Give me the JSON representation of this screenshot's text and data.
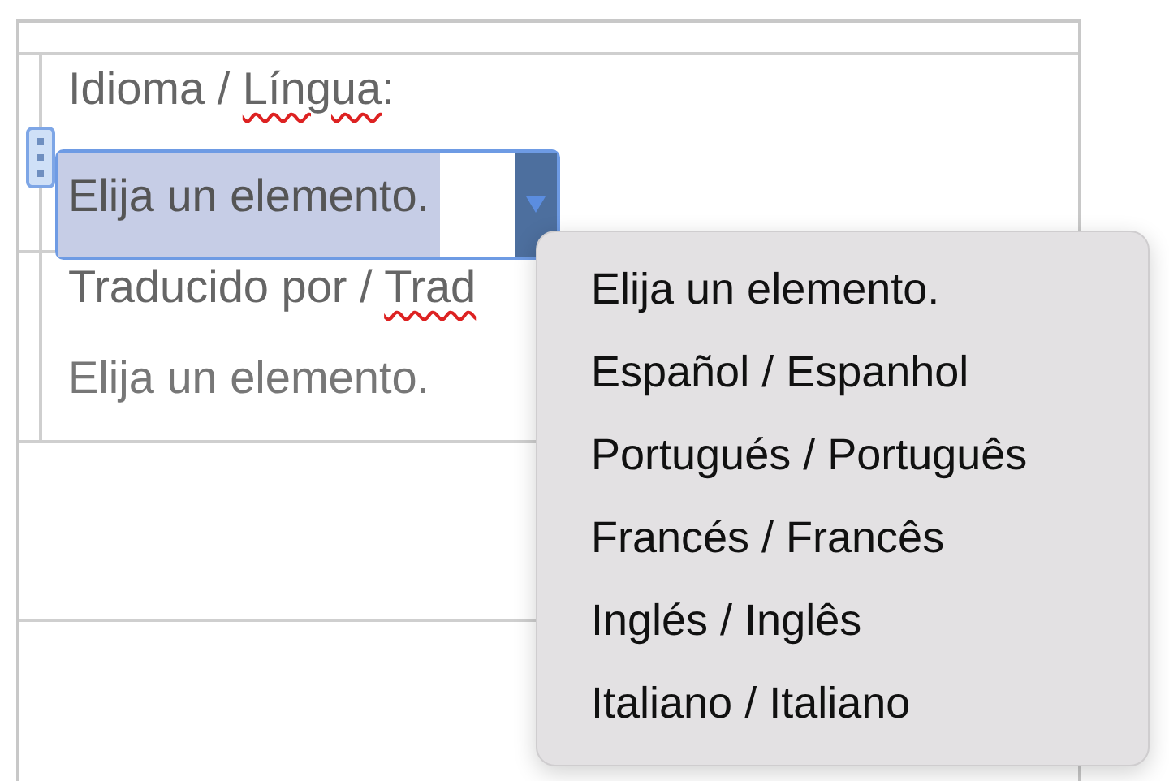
{
  "fields": [
    {
      "label": [
        {
          "text": "Idioma / "
        },
        {
          "text": "Língua",
          "misspelled": true
        },
        {
          "text": ":"
        }
      ],
      "value": "Elija un elemento.",
      "active": true
    },
    {
      "label": [
        {
          "text": "Traducido por / "
        },
        {
          "text": "Trad",
          "misspelled": true
        }
      ],
      "value": "Elija un elemento.",
      "active": false
    }
  ],
  "dropdown": {
    "options": [
      "Elija un elemento.",
      "Español / Espanhol",
      "Portugués / Português",
      "Francés / Francês",
      "Inglés / Inglês",
      "Italiano / Italiano"
    ]
  }
}
